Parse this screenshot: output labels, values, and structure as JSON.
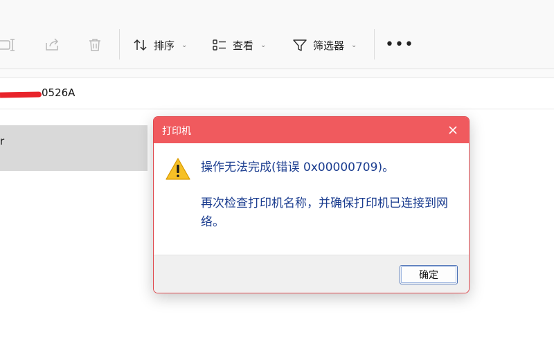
{
  "toolbar": {
    "icons": {
      "rename": "rename-icon",
      "share": "share-icon",
      "delete": "trash-icon",
      "more": "more-options-icon"
    },
    "sort_label": "排序",
    "view_label": "查看",
    "filter_label": "筛选器",
    "more_label": "•••",
    "caret": "⌄"
  },
  "address": {
    "path_text": "0526A"
  },
  "content": {
    "selected_item_text": "r"
  },
  "dialog": {
    "title": "打印机",
    "message_line1": "操作无法完成(错误 0x00000709)。",
    "message_line2": "再次检查打印机名称，并确保打印机已连接到网络。",
    "ok_label": "确定",
    "colors": {
      "title_bar": "#f05a5e",
      "border": "#e0474c",
      "message_text": "#1a3c8f"
    }
  }
}
